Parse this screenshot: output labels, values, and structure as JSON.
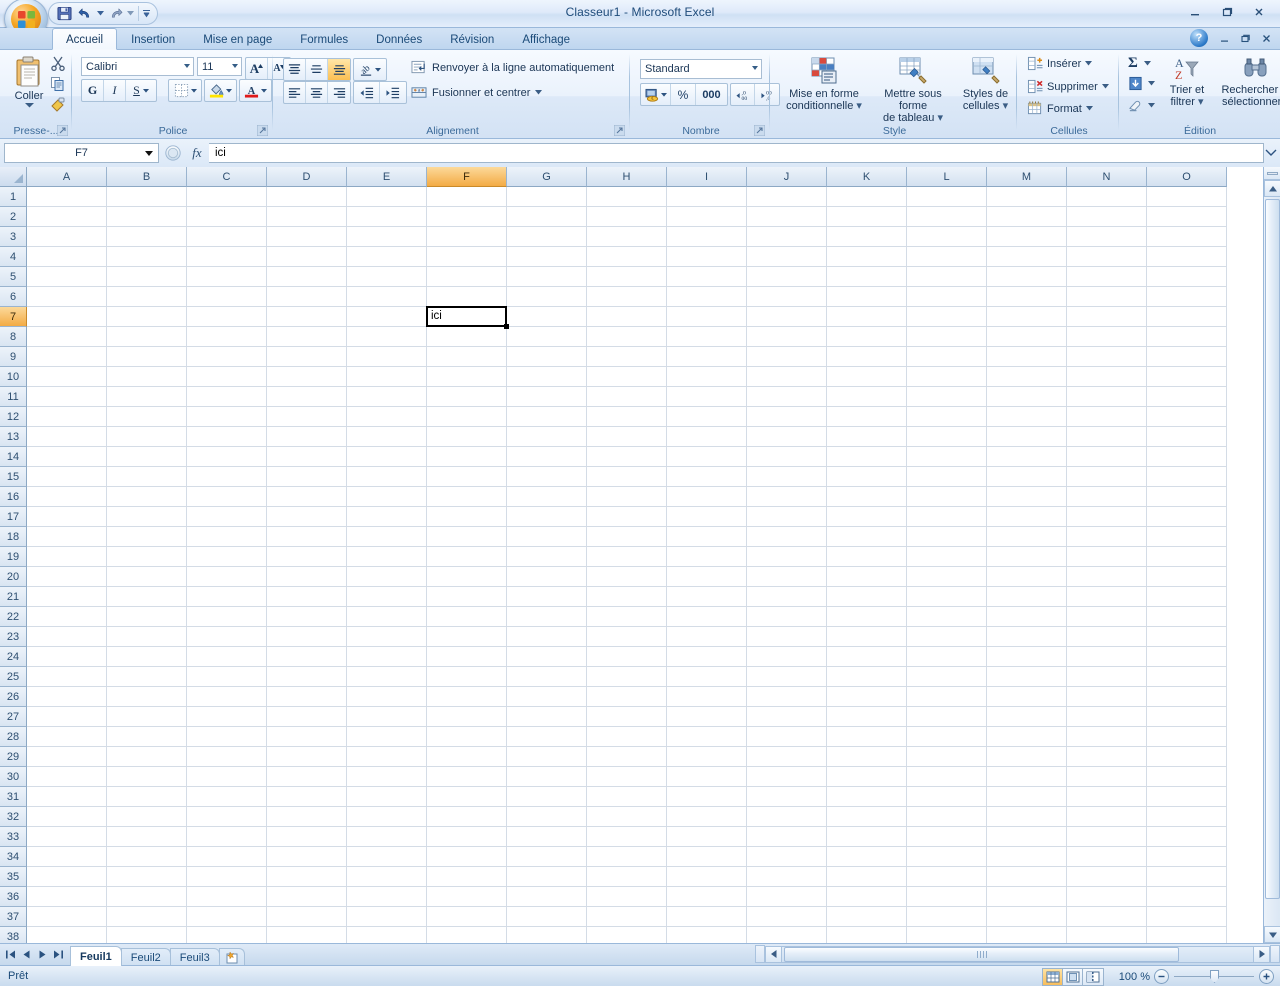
{
  "window": {
    "title": "Classeur1  -  Microsoft Excel",
    "minimize": "–",
    "restore": "❐",
    "close": "✕",
    "help": "?"
  },
  "quick_access": {
    "save": "save-icon",
    "undo": "undo-icon",
    "redo": "redo-icon",
    "customize": "customize-icon"
  },
  "ribbon": {
    "tabs": [
      {
        "label": "Accueil",
        "active": true
      },
      {
        "label": "Insertion",
        "active": false
      },
      {
        "label": "Mise en page",
        "active": false
      },
      {
        "label": "Formules",
        "active": false
      },
      {
        "label": "Données",
        "active": false
      },
      {
        "label": "Révision",
        "active": false
      },
      {
        "label": "Affichage",
        "active": false
      }
    ],
    "groups": {
      "clipboard": {
        "label": "Presse-...",
        "paste": "Coller",
        "cut": "cut-icon",
        "copy": "copy-icon",
        "format_painter": "format-painter-icon"
      },
      "font": {
        "label": "Police",
        "font_name": "Calibri",
        "font_size": "11",
        "grow": "A",
        "shrink": "A",
        "bold": "G",
        "italic": "I",
        "underline": "S",
        "borders": "borders-icon",
        "fill_color": "fill-color-icon",
        "font_color": "A"
      },
      "alignment": {
        "label": "Alignement",
        "align_top": "align-top-icon",
        "align_middle": "align-middle-icon",
        "align_bottom": "align-bottom-icon",
        "orientation": "orientation-icon",
        "align_left": "align-left-icon",
        "align_center": "align-center-icon",
        "align_right": "align-right-icon",
        "decrease_indent": "decrease-indent-icon",
        "increase_indent": "increase-indent-icon",
        "wrap_text": "Renvoyer à la ligne automatiquement",
        "merge_center": "Fusionner et centrer"
      },
      "number": {
        "label": "Nombre",
        "format": "Standard",
        "currency": "currency-icon",
        "percent": "%",
        "thousands": "000",
        "increase_decimal": "increase-decimal-icon",
        "decrease_decimal": "decrease-decimal-icon"
      },
      "style": {
        "label": "Style",
        "conditional": "Mise en forme\nconditionnelle",
        "conditional_l1": "Mise en forme",
        "conditional_l2": "conditionnelle",
        "table_l1": "Mettre sous forme",
        "table_l2": "de tableau",
        "cellstyles_l1": "Styles de",
        "cellstyles_l2": "cellules"
      },
      "cells": {
        "label": "Cellules",
        "insert": "Insérer",
        "delete": "Supprimer",
        "format": "Format"
      },
      "editing": {
        "label": "Édition",
        "autosum": "Σ",
        "fill": "fill-icon",
        "clear": "clear-icon",
        "sort_l1": "Trier et",
        "sort_l2": "filtrer",
        "find_l1": "Rechercher et",
        "find_l2": "sélectionner"
      }
    }
  },
  "formula_bar": {
    "name_box": "F7",
    "cancel": "cancel-icon",
    "enter": "enter-icon",
    "function": "fx",
    "content": "ici"
  },
  "grid": {
    "columns": [
      "A",
      "B",
      "C",
      "D",
      "E",
      "F",
      "G",
      "H",
      "I",
      "J",
      "K",
      "L",
      "M",
      "N",
      "O"
    ],
    "selected_column": "F",
    "rows": [
      1,
      2,
      3,
      4,
      5,
      6,
      7,
      8,
      9,
      10,
      11,
      12,
      13,
      14,
      15,
      16,
      17,
      18,
      19,
      20,
      21,
      22,
      23,
      24,
      25,
      26,
      27,
      28,
      29,
      30,
      31,
      32,
      33,
      34,
      35,
      36,
      37,
      38
    ],
    "selected_row": 7,
    "active_cell": "F7",
    "active_cell_value": "ici"
  },
  "sheets": {
    "tabs": [
      {
        "label": "Feuil1",
        "active": true
      },
      {
        "label": "Feuil2",
        "active": false
      },
      {
        "label": "Feuil3",
        "active": false
      }
    ],
    "new_sheet": "new-sheet-icon",
    "nav_first": "⏮",
    "nav_prev": "◀",
    "nav_next": "▶",
    "nav_last": "⏭"
  },
  "status": {
    "text": "Prêt",
    "view_normal": "normal-view-icon",
    "view_layout": "page-layout-icon",
    "view_break": "page-break-icon",
    "zoom": "100 %",
    "zoom_out": "−",
    "zoom_in": "+"
  }
}
